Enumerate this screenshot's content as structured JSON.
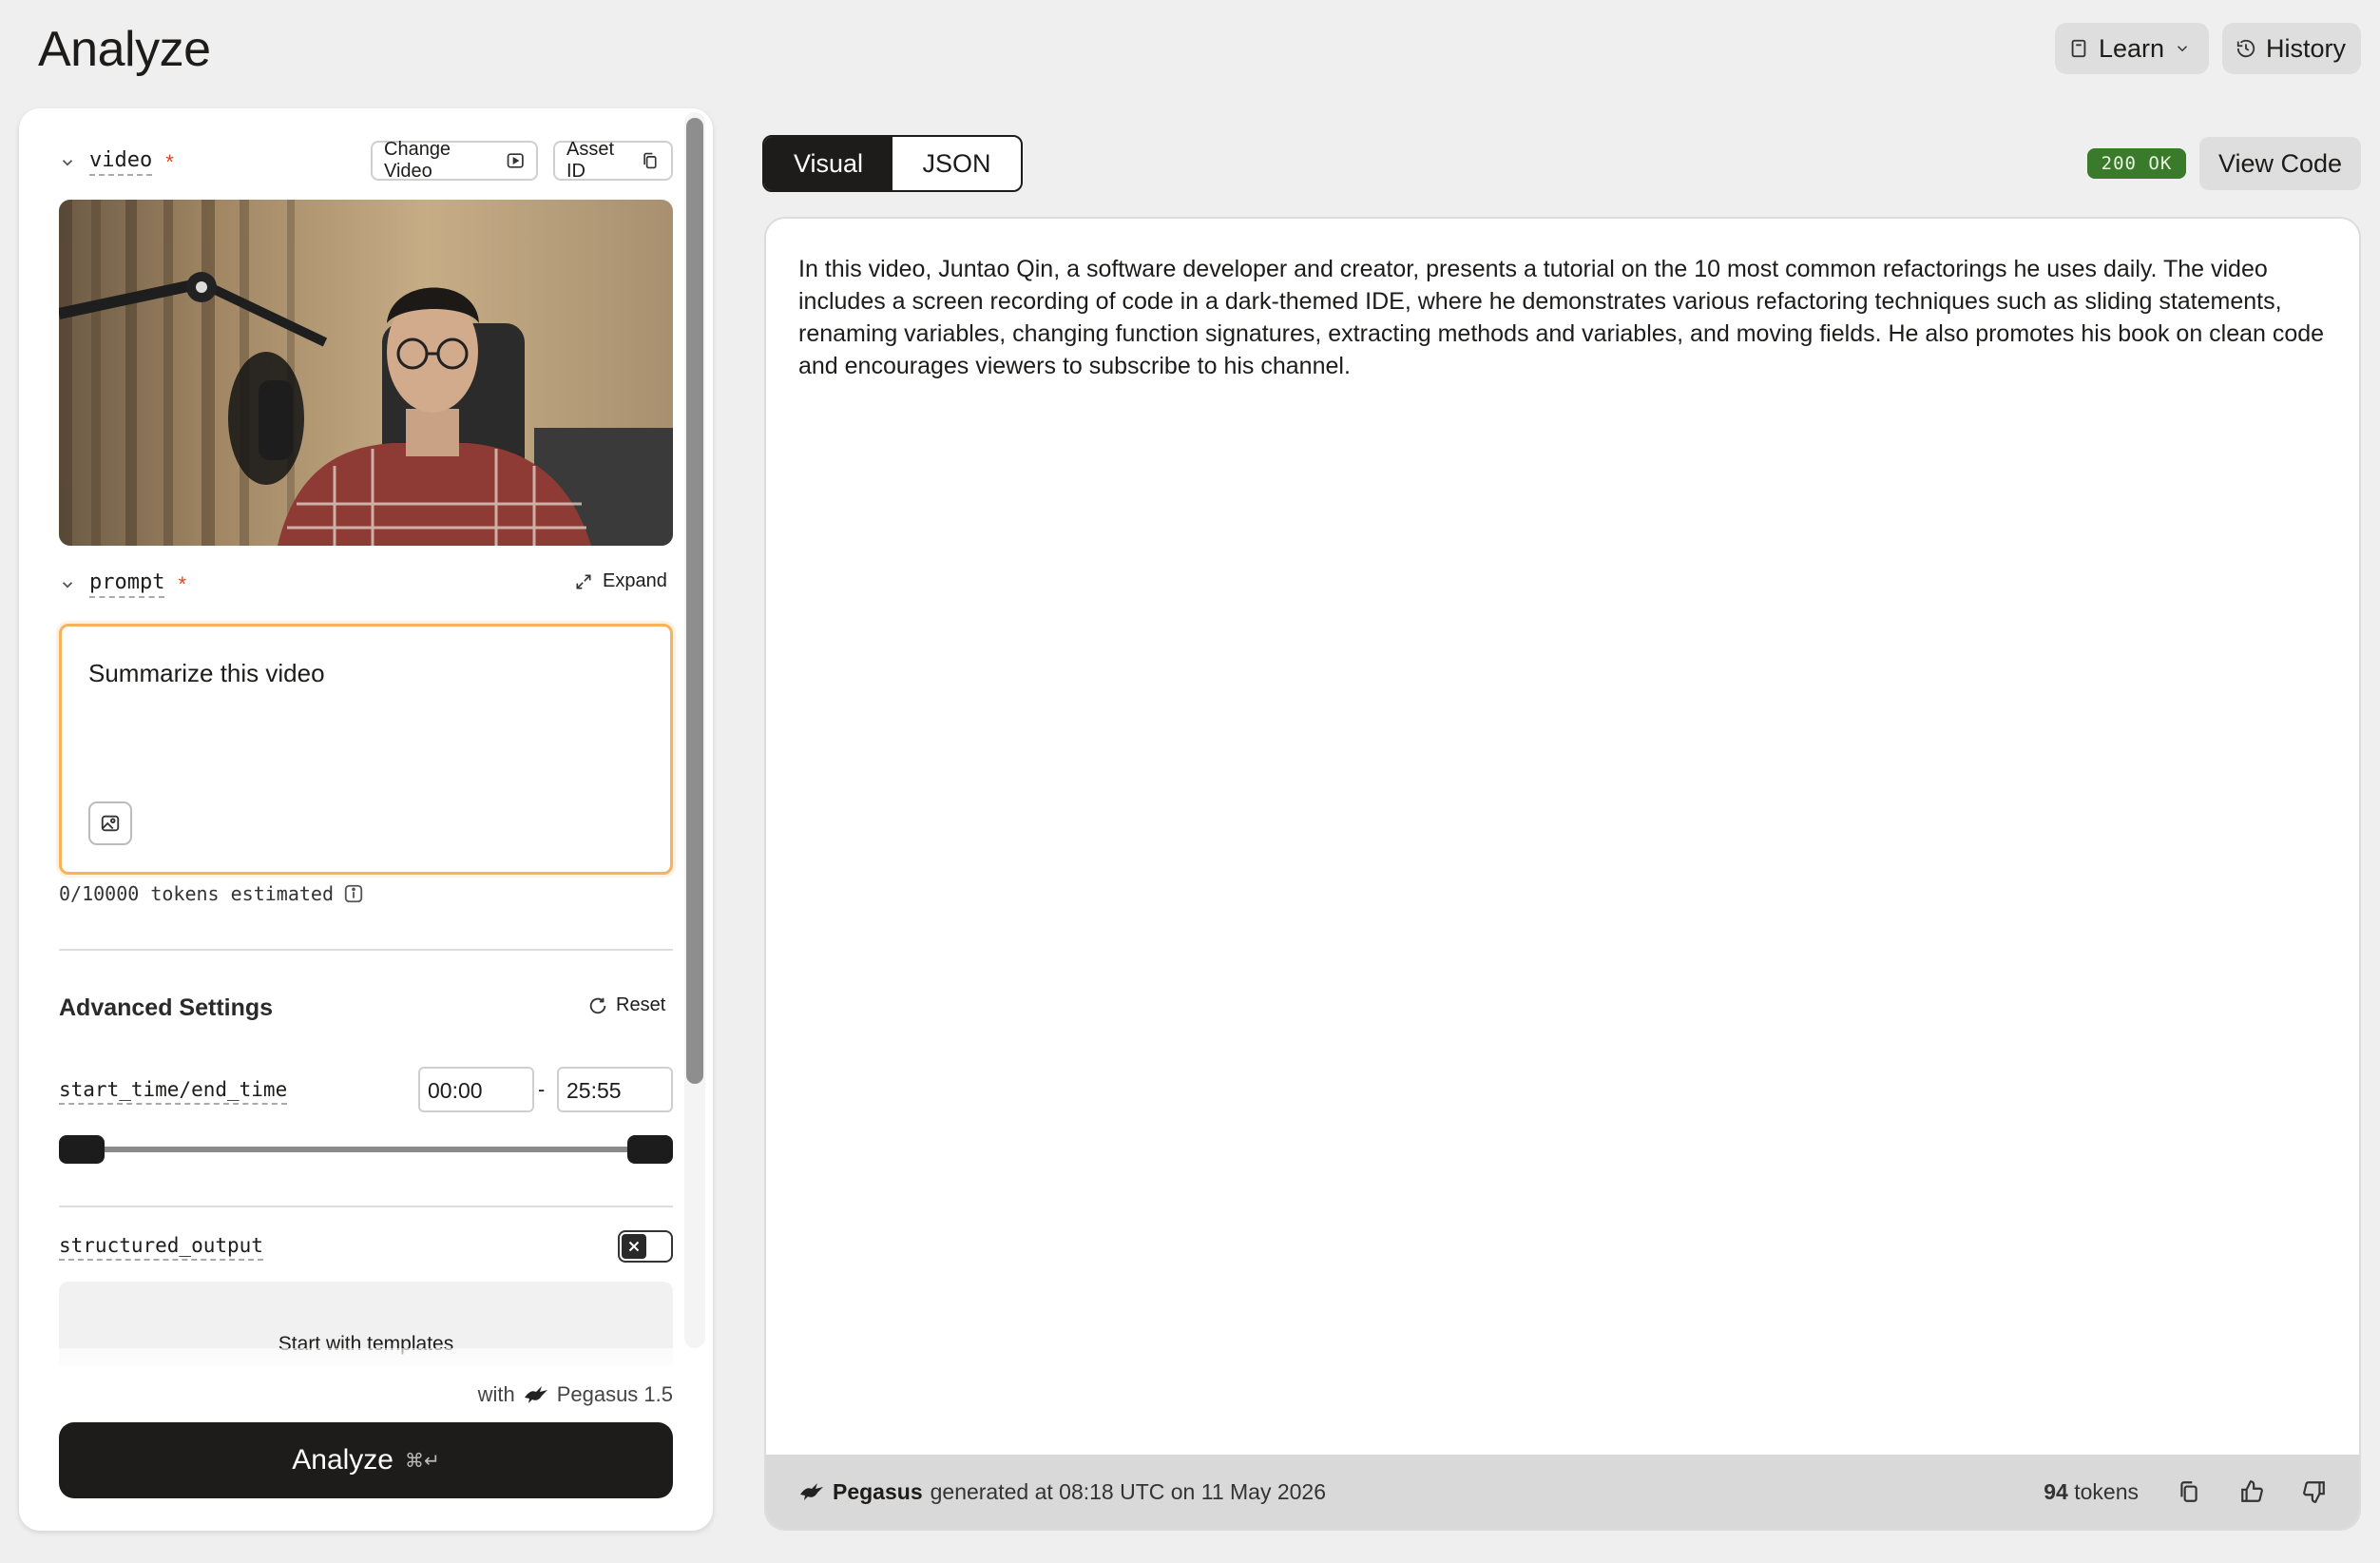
{
  "header": {
    "title": "Analyze",
    "learn_label": "Learn",
    "history_label": "History"
  },
  "video_field": {
    "name": "video",
    "required_mark": "*",
    "change_label": "Change Video",
    "asset_label": "Asset ID"
  },
  "prompt_field": {
    "name": "prompt",
    "required_mark": "*",
    "expand_label": "Expand",
    "value": "Summarize this video",
    "tokens_text": "0/10000 tokens estimated"
  },
  "advanced": {
    "title": "Advanced Settings",
    "reset_label": "Reset",
    "time_label": "start_time/end_time",
    "start_time": "00:00",
    "end_time": "25:55",
    "separator": "-",
    "slider_start_fraction": 0.0,
    "slider_end_fraction": 1.0,
    "structured_label": "structured_output",
    "structured_enabled": false,
    "templates_label": "Start with templates"
  },
  "footer_action": {
    "with_label": "with",
    "model_label": "Pegasus 1.5",
    "analyze_label": "Analyze",
    "shortcut": "⌘↵"
  },
  "result": {
    "tabs": [
      {
        "label": "Visual",
        "active": true
      },
      {
        "label": "JSON",
        "active": false
      }
    ],
    "status": "200 OK",
    "view_code_label": "View Code",
    "text": "In this video, Juntao Qin, a software developer and creator, presents a tutorial on the 10 most common refactorings he uses daily. The video includes a screen recording of code in a dark-themed IDE, where he demonstrates various refactoring techniques such as sliding statements, renaming variables, changing function signatures, extracting methods and variables, and moving fields. He also promotes his book on clean code and encourages viewers to subscribe to his channel.",
    "model": "Pegasus",
    "generated_text": "generated at 08:18 UTC on 11 May 2026",
    "token_count": "94",
    "tokens_label": "tokens"
  },
  "colors": {
    "accent_orange": "#f6b25d",
    "status_green": "#3a7a2b",
    "required_red": "#e0451e",
    "dark": "#1d1c1b"
  }
}
